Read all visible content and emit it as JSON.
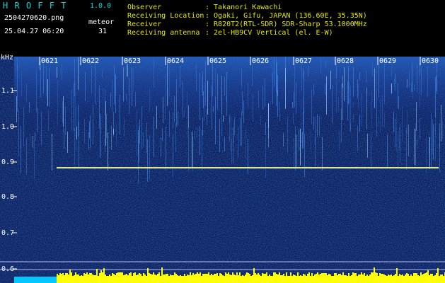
{
  "header": {
    "app_name": "H R O F F T",
    "version": "1.0.0",
    "filename": "2504270620.png",
    "category": "meteor",
    "timestamp": "25.04.27 06:20",
    "count": "31",
    "observer_label": "Observer",
    "observer_value": ": Takanori Kawachi",
    "location_label": "Receiving Location",
    "location_value": ": Ogaki, Gifu, JAPAN (136.60E, 35.35N)",
    "receiver_label": "Receiver",
    "receiver_value": ": R820T2(RTL-SDR) SDR-Sharp 53.1000MHz",
    "antenna_label": "Receiving antenna",
    "antenna_value": ": 2el-HB9CV Vertical (el. E-W)"
  },
  "spectrogram": {
    "unit_label": "kHz",
    "freq_ticks": [
      "1.1",
      "1.0",
      "0.9",
      "0.8",
      "0.7",
      "0.6"
    ],
    "minute_labels": [
      "0621",
      "0622",
      "0623",
      "0624",
      "0625",
      "0626",
      "0627",
      "0628",
      "0629",
      "0630"
    ],
    "carrier_freq_khz": 0.885,
    "colors": {
      "background": "#0a1650",
      "carrier": "#ffe070",
      "bottom_bar": "#ffff00",
      "left_bar": "#00c8ff"
    }
  }
}
